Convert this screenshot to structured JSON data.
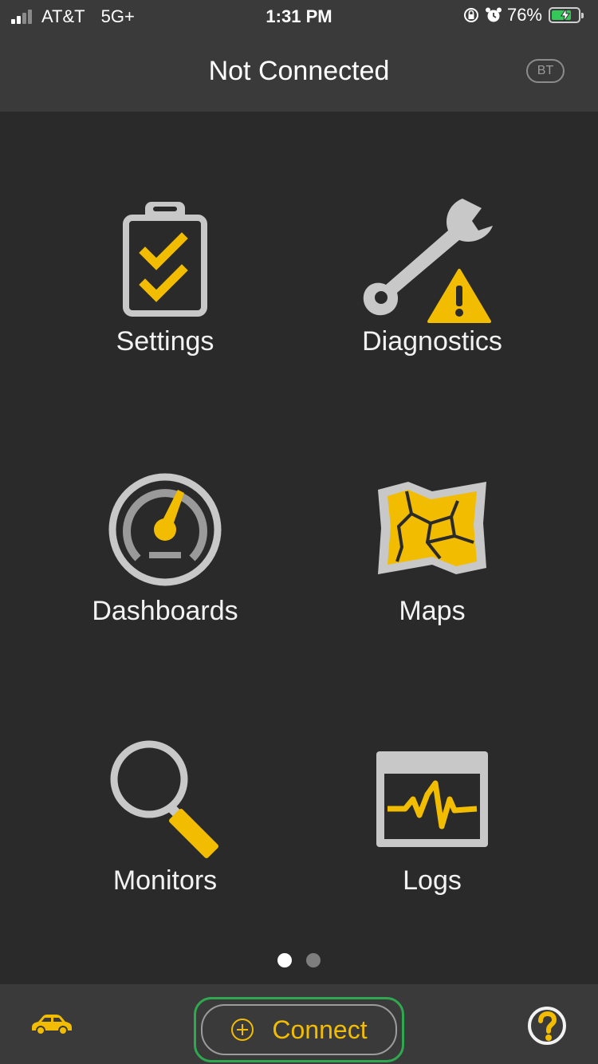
{
  "status_bar": {
    "carrier": "AT&T",
    "network": "5G+",
    "time": "1:31 PM",
    "battery_percent": "76%",
    "battery_level": 0.76,
    "icons": [
      "signal-icon",
      "orientation-lock-icon",
      "alarm-icon",
      "battery-charging-icon"
    ]
  },
  "header": {
    "title": "Not Connected",
    "bt_badge": "BT"
  },
  "menu": {
    "items": [
      {
        "label": "Settings",
        "icon": "clipboard-checklist-icon"
      },
      {
        "label": "Diagnostics",
        "icon": "wrench-warning-icon"
      },
      {
        "label": "Dashboards",
        "icon": "gauge-icon"
      },
      {
        "label": "Maps",
        "icon": "map-icon"
      },
      {
        "label": "Monitors",
        "icon": "magnifier-icon"
      },
      {
        "label": "Logs",
        "icon": "waveform-log-icon"
      }
    ]
  },
  "pagination": {
    "current": 1,
    "total": 2
  },
  "bottom_bar": {
    "connect_label": "Connect",
    "left_icon": "car-icon",
    "right_icon": "help-icon"
  },
  "colors": {
    "accent": "#f2bc00",
    "background": "#2a2a2a",
    "bar": "#3a3a3a",
    "icon_gray": "#c8c8c8",
    "highlight": "#2fa84f"
  }
}
